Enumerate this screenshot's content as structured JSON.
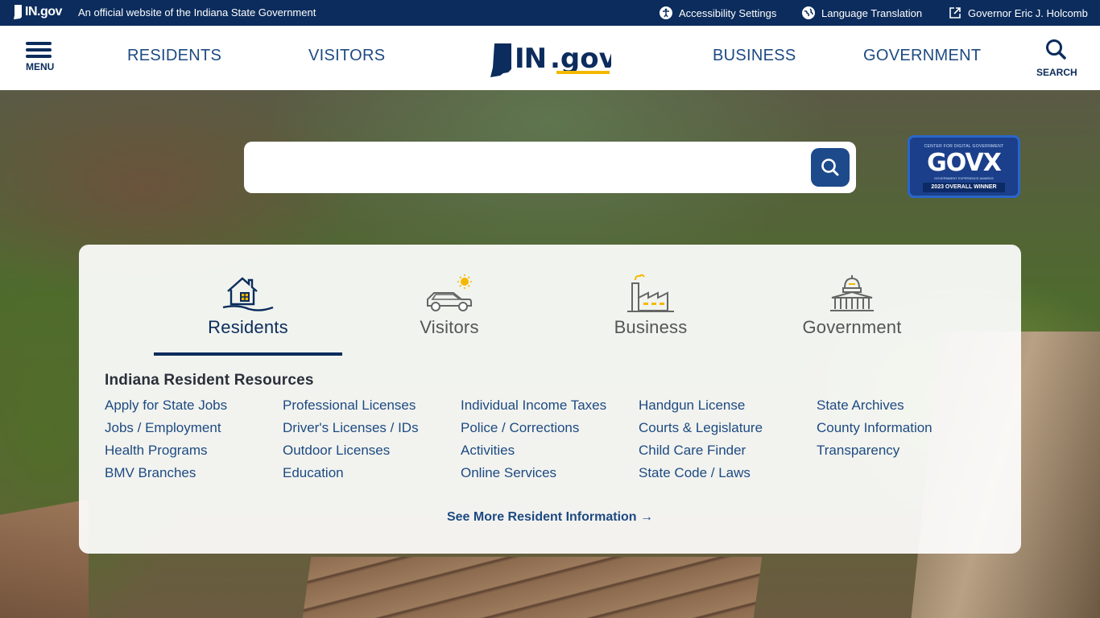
{
  "topbar": {
    "brand": "IN.gov",
    "tagline": "An official website of the Indiana State Government",
    "links": [
      {
        "label": "Accessibility Settings",
        "icon": "accessibility-icon"
      },
      {
        "label": "Language Translation",
        "icon": "globe-icon"
      },
      {
        "label": "Governor Eric J. Holcomb",
        "icon": "external-link-icon"
      }
    ]
  },
  "header": {
    "menu_label": "MENU",
    "search_label": "SEARCH",
    "nav": [
      "RESIDENTS",
      "VISITORS",
      "BUSINESS",
      "GOVERNMENT"
    ],
    "logo_text": "IN.gov"
  },
  "search": {
    "value": "",
    "button_icon": "search-icon"
  },
  "badge": {
    "top": "CENTER FOR DIGITAL GOVERNMENT",
    "word": "GOVX",
    "sub": "GOVERNMENT EXPERIENCE AWARDS",
    "winner": "2023 OVERALL WINNER"
  },
  "panel": {
    "tabs": [
      {
        "label": "Residents",
        "icon": "house-icon",
        "active": true
      },
      {
        "label": "Visitors",
        "icon": "car-icon",
        "active": false
      },
      {
        "label": "Business",
        "icon": "factory-icon",
        "active": false
      },
      {
        "label": "Government",
        "icon": "capitol-icon",
        "active": false
      }
    ],
    "heading": "Indiana Resident Resources",
    "columns": [
      [
        "Apply for State Jobs",
        "Jobs / Employment",
        "Health Programs",
        "BMV Branches"
      ],
      [
        "Professional Licenses",
        "Driver's Licenses / IDs",
        "Outdoor Licenses",
        "Education"
      ],
      [
        "Individual Income Taxes",
        "Police / Corrections",
        "Activities",
        "Online Services"
      ],
      [
        "Handgun License",
        "Courts & Legislature",
        "Child Care Finder",
        "State Code / Laws"
      ],
      [
        "State Archives",
        "County Information",
        "Transparency"
      ]
    ],
    "see_more": "See More Resident Information →"
  },
  "colors": {
    "navy": "#0b2c5c",
    "link": "#1d4a82",
    "accent_gold": "#f5b800"
  }
}
